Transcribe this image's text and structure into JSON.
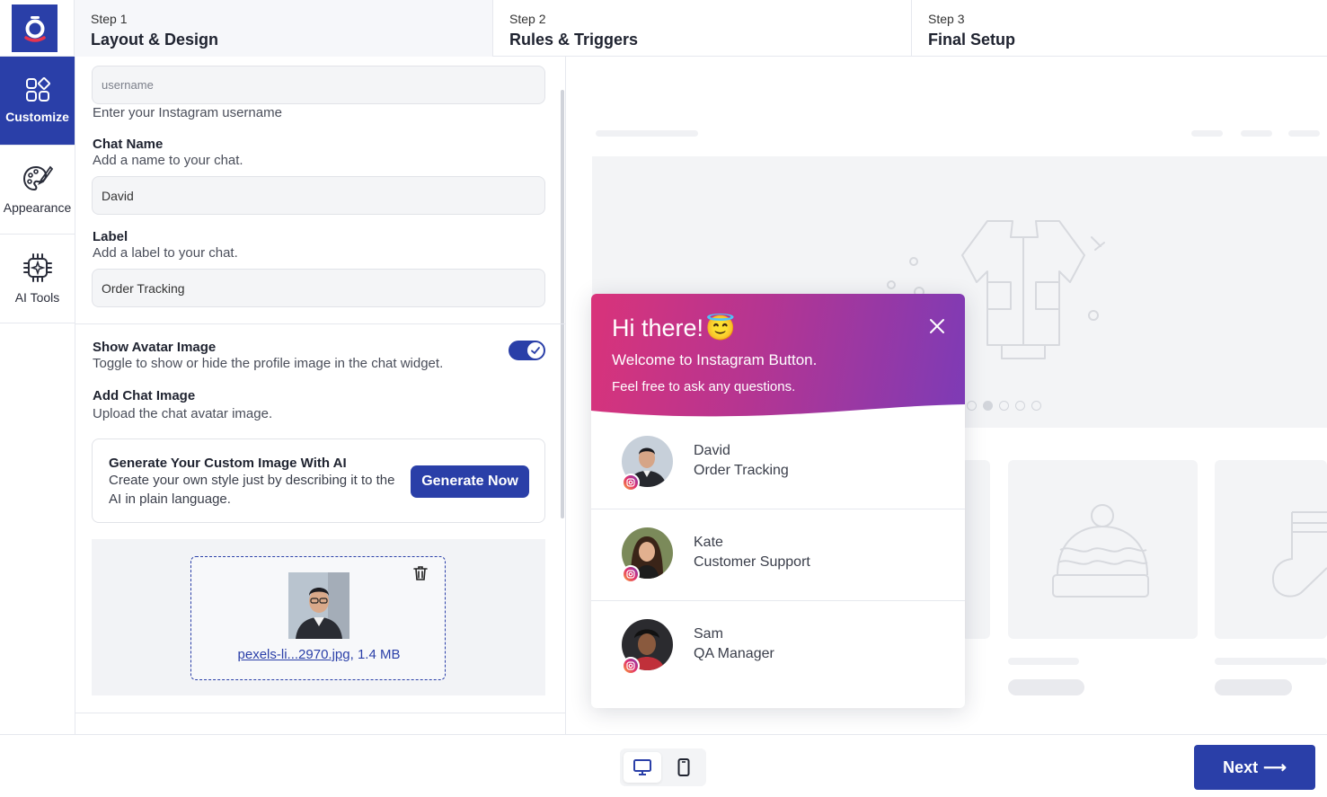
{
  "steps": [
    {
      "num": "Step 1",
      "title": "Layout & Design"
    },
    {
      "num": "Step 2",
      "title": "Rules & Triggers"
    },
    {
      "num": "Step 3",
      "title": "Final Setup"
    }
  ],
  "rail": [
    {
      "label": "Customize",
      "icon": "customize-icon"
    },
    {
      "label": "Appearance",
      "icon": "palette-icon"
    },
    {
      "label": "AI Tools",
      "icon": "chip-icon"
    }
  ],
  "form": {
    "username_placeholder": "username",
    "username_help": "Enter your Instagram username",
    "chat_name_label": "Chat Name",
    "chat_name_help": "Add a name to your chat.",
    "chat_name_value": "David",
    "label_label": "Label",
    "label_help": "Add a label to your chat.",
    "label_value": "Order Tracking",
    "avatar_toggle_label": "Show Avatar Image",
    "avatar_toggle_help": "Toggle to show or hide the profile image in the chat widget.",
    "avatar_toggle_on": true,
    "chat_image_label": "Add Chat Image",
    "chat_image_help": "Upload the chat avatar image."
  },
  "ai_card": {
    "title": "Generate Your Custom Image With AI",
    "desc": "Create your own style just by describing it to the AI in plain language.",
    "button": "Generate Now"
  },
  "upload": {
    "file_name": "pexels-li...2970.jpg",
    "file_size": ", 1.4 MB"
  },
  "widget": {
    "title": "Hi there!",
    "emoji": "😇",
    "subtitle": "Welcome to Instagram Button.",
    "subtitle2": "Feel free to ask any questions.",
    "agents": [
      {
        "name": "David",
        "role": "Order Tracking"
      },
      {
        "name": "Kate",
        "role": "Customer Support"
      },
      {
        "name": "Sam",
        "role": "QA Manager"
      }
    ]
  },
  "footer": {
    "next_label": "Next",
    "next_arrow": "⟶"
  },
  "colors": {
    "brand": "#2a3fa8",
    "widget_gradient_start": "#d9337a",
    "widget_gradient_end": "#7d3bb6"
  }
}
